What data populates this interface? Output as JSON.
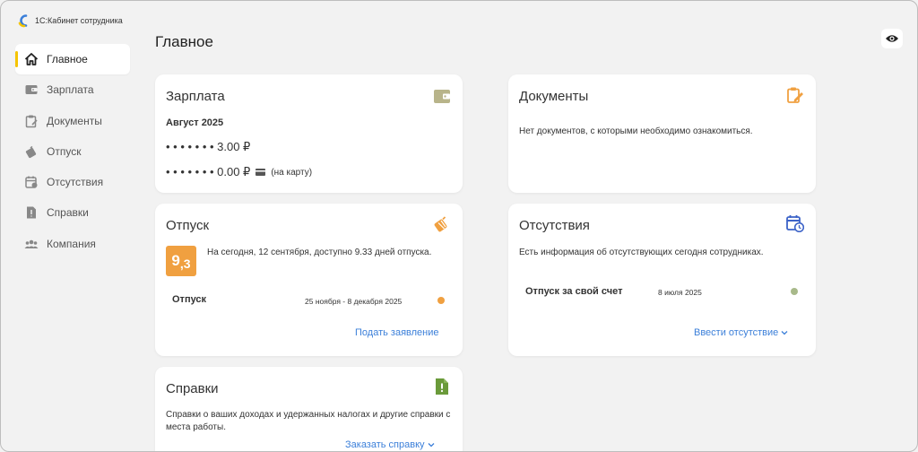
{
  "app": {
    "title": "1С:Кабинет сотрудника"
  },
  "page": {
    "title": "Главное"
  },
  "sidebar": {
    "items": [
      {
        "label": "Главное",
        "icon": "home-icon",
        "active": true
      },
      {
        "label": "Зарплата",
        "icon": "wallet-icon"
      },
      {
        "label": "Документы",
        "icon": "clipboard-icon"
      },
      {
        "label": "Отпуск",
        "icon": "luggage-icon"
      },
      {
        "label": "Отсутствия",
        "icon": "calendar-icon"
      },
      {
        "label": "Справки",
        "icon": "document-icon"
      },
      {
        "label": "Компания",
        "icon": "people-icon"
      }
    ]
  },
  "salary": {
    "title": "Зарплата",
    "period": "Август 2025",
    "row1_amount": "• • • • • • • 3.00 ₽",
    "row2_amount": "• • • • • • • 0.00 ₽",
    "row2_note": "(на карту)"
  },
  "documents": {
    "title": "Документы",
    "message": "Нет документов, с которыми необходимо ознакомиться."
  },
  "vacation": {
    "title": "Отпуск",
    "days_badge": "9,3",
    "days_badge_int": "9",
    "days_badge_frac": ",3",
    "summary": "На сегодня, 12 сентября, доступно 9.33 дней отпуска.",
    "entry_label": "Отпуск",
    "entry_dates": "25 ноября - 8 декабря 2025",
    "entry_status_color": "#f0a040",
    "action": "Подать заявление"
  },
  "absences": {
    "title": "Отсутствия",
    "message": "Есть информация об отсутствующих сегодня сотрудниках.",
    "entry_label": "Отпуск за свой счет",
    "entry_date": "8 июля 2025",
    "entry_status_color": "#a8b98a",
    "action": "Ввести отсутствие"
  },
  "certificates": {
    "title": "Справки",
    "message": "Справки о ваших доходах и удержанных налогах и другие справки с места работы.",
    "action": "Заказать справку"
  },
  "colors": {
    "accent_yellow": "#f5c400",
    "link_blue": "#3b7fd9",
    "icon_olive": "#b8b48a",
    "icon_orange": "#f0a040",
    "icon_blue": "#3c63c8",
    "icon_green": "#6a9a3a"
  }
}
